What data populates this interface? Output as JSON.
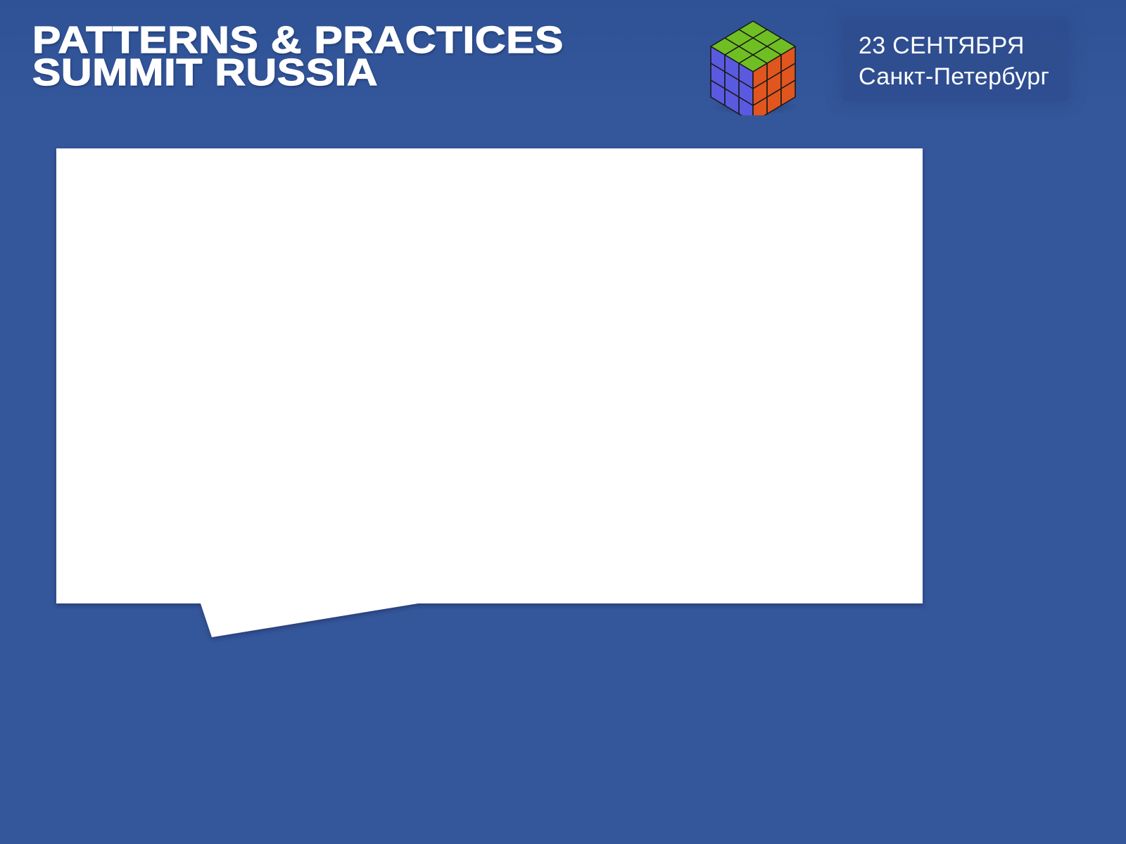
{
  "slide": {
    "title_line_1": "PATTERNS & PRACTICES",
    "title_line_2": "SUMMIT RUSSIA",
    "event_date": "23 СЕНТЯБРЯ",
    "event_city": "Санкт-Петербург",
    "logo_icon": "rubiks-cube-logo-icon"
  },
  "colors": {
    "background": "#34569a",
    "panel": "#ffffff",
    "cube_top": "#6fbf24",
    "cube_left": "#5a5ae0",
    "cube_right": "#e0561e"
  }
}
